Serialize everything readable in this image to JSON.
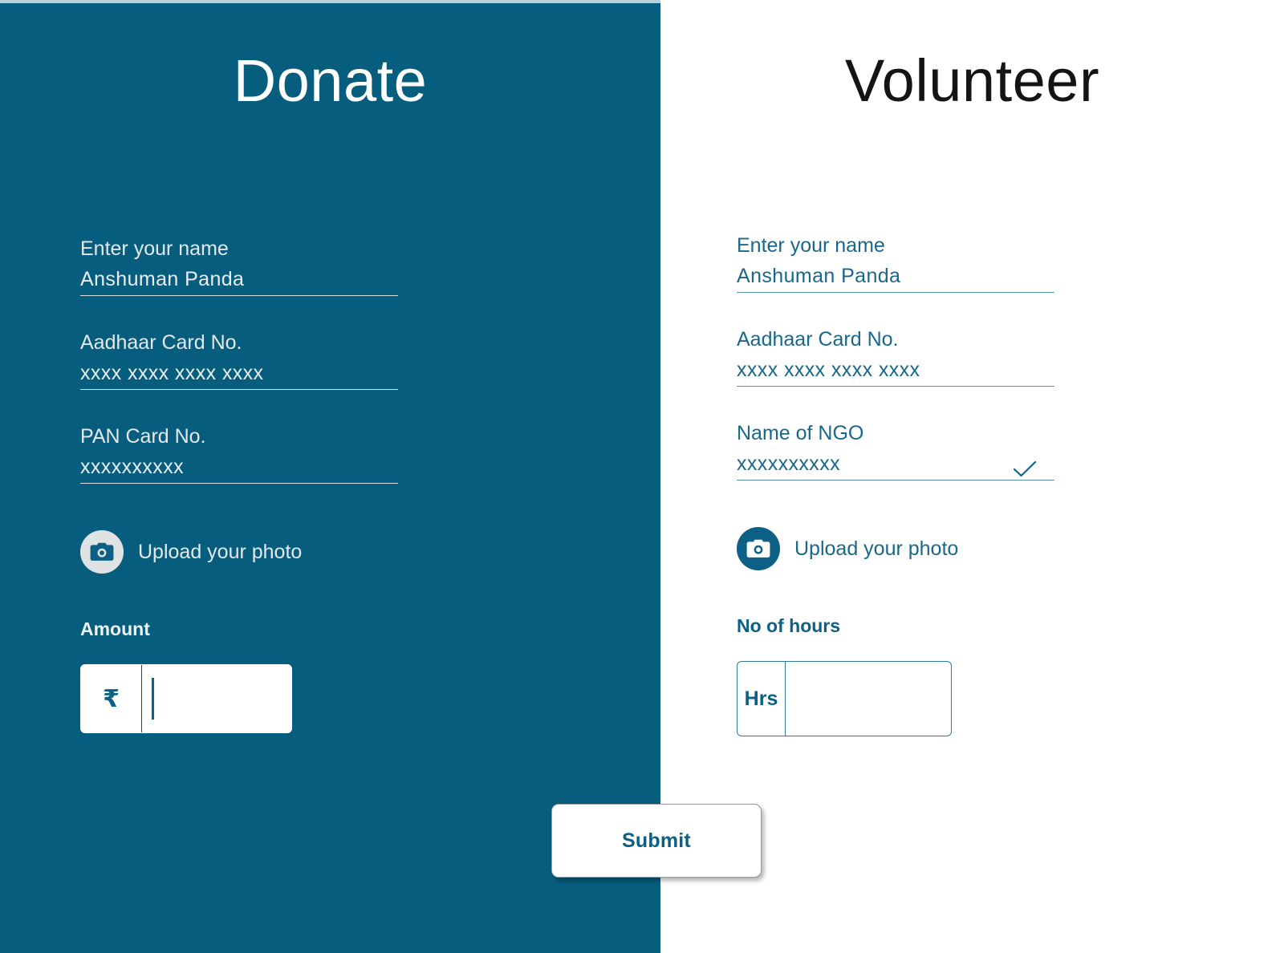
{
  "colors": {
    "brand_blue": "#075D7E",
    "panel_white": "#ffffff",
    "text_on_blue": "#e8eef1",
    "text_blue": "#19688a",
    "accent_blue": "#0c6085"
  },
  "donate": {
    "title": "Donate",
    "fields": [
      {
        "label": "Enter your name",
        "value": "Anshuman Panda",
        "placeholder": "Enter your name"
      },
      {
        "label": "Aadhaar Card No.",
        "value": "xxxx xxxx xxxx xxxx",
        "placeholder": "xxxx xxxx xxxx xxxx"
      },
      {
        "label": "PAN Card No.",
        "value": "xxxxxxxxxx",
        "placeholder": "xxxxxxxxxx"
      }
    ],
    "upload": {
      "icon": "camera-icon",
      "label": "Upload your photo"
    },
    "amount": {
      "heading": "Amount",
      "prefix": "₹",
      "value": "",
      "placeholder": ""
    }
  },
  "volunteer": {
    "title": "Volunteer",
    "fields": [
      {
        "label": "Enter your name",
        "value": "Anshuman Panda",
        "placeholder": "Enter your name",
        "checked": false
      },
      {
        "label": "Aadhaar Card No.",
        "value": "xxxx xxxx xxxx xxxx",
        "placeholder": "xxxx xxxx xxxx xxxx",
        "checked": false
      },
      {
        "label": "Name of NGO",
        "value": "xxxxxxxxxx",
        "placeholder": "xxxxxxxxxx",
        "checked": true
      }
    ],
    "upload": {
      "icon": "camera-icon",
      "label": "Upload your photo"
    },
    "hours": {
      "heading": "No of hours",
      "prefix": "Hrs",
      "value": "",
      "placeholder": ""
    }
  },
  "submit": {
    "label": "Submit"
  }
}
